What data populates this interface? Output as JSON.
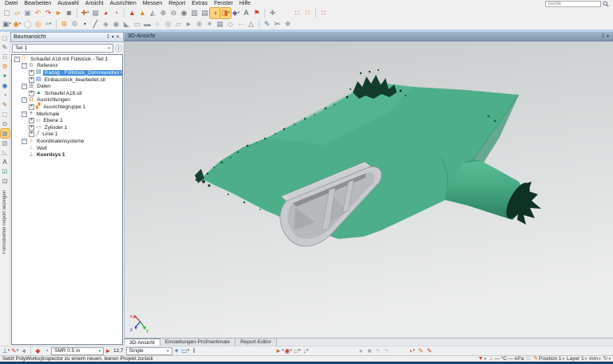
{
  "menu": {
    "items": [
      "Datei",
      "Bearbeiten",
      "Auswahl",
      "Ansicht",
      "Ausrichten",
      "Messen",
      "Report",
      "Extras",
      "Fenster",
      "Hilfe"
    ],
    "search_placeholder": "Suche"
  },
  "toolbar_row1": [
    {
      "name": "new-project",
      "g": "▢",
      "c": "#8d97a3"
    },
    {
      "name": "open-project",
      "g": "▱",
      "c": "#e08a28"
    },
    {
      "name": "save-project",
      "g": "▣",
      "c": "#8d97a3"
    },
    {
      "name": "undo",
      "g": "↶",
      "c": "#e08a28"
    },
    {
      "name": "redo",
      "g": "↷",
      "c": "#c2452c"
    },
    {
      "name": "share",
      "g": "►",
      "c": "#e08a28"
    },
    {
      "name": "snapshot",
      "g": "◙",
      "c": "#6e7681"
    },
    {
      "sep": true
    },
    {
      "name": "selection-tool",
      "g": "✚",
      "c": "#b8742c",
      "dd": true
    },
    {
      "name": "scene-view",
      "g": "▦",
      "c": "#8d97a3"
    },
    {
      "name": "probe-device-1",
      "g": "◕",
      "c": "#c2452c"
    },
    {
      "name": "probe-device-2",
      "g": "◔",
      "c": "#c2452c"
    },
    {
      "sep": true
    },
    {
      "name": "align-tool-1",
      "g": "▲",
      "c": "#c2452c"
    },
    {
      "name": "align-tool-2",
      "g": "▲",
      "c": "#e08a28"
    },
    {
      "name": "align-tool-3",
      "g": "◭",
      "c": "#8d97a3"
    },
    {
      "name": "zoom-in",
      "g": "⊕",
      "c": "#6e7681"
    },
    {
      "name": "zoom-out",
      "g": "⊖",
      "c": "#6e7681"
    },
    {
      "name": "eye-view",
      "g": "◉",
      "c": "#6e7681"
    },
    {
      "name": "window-split-1",
      "g": "▥",
      "c": "#6e7681"
    },
    {
      "name": "window-split-2",
      "g": "▤",
      "c": "#6e7681"
    },
    {
      "name": "flip-normals",
      "g": "◑",
      "c": "#d2691e",
      "hl": true
    },
    {
      "name": "orient-view",
      "g": "◨",
      "c": "#d2691e",
      "hl": true,
      "dd": true
    },
    {
      "name": "annotation",
      "g": "◆",
      "c": "#7b68a8",
      "dd": true
    },
    {
      "name": "text-label",
      "g": "A",
      "c": "#3c4650"
    },
    {
      "name": "flag-note",
      "g": "⚑",
      "c": "#c2452c"
    },
    {
      "sep": true
    },
    {
      "name": "small-crosshair",
      "g": "✚",
      "c": "#8d97a3"
    },
    {
      "gap": true
    },
    {
      "name": "cluster-objects-1",
      "g": "∷",
      "c": "#c2452c"
    },
    {
      "name": "cluster-objects-2",
      "g": "∷",
      "c": "#d2691e"
    },
    {
      "sep": true
    },
    {
      "name": "cluster-objects-3",
      "g": "∷",
      "c": "#c2452c"
    }
  ],
  "toolbar_row2": [
    {
      "name": "tree-display",
      "g": "▣",
      "c": "#6e7681",
      "dd": true
    },
    {
      "name": "control-reviewer",
      "g": "◉",
      "c": "#e08a28",
      "dd": true
    },
    {
      "name": "circle-tool",
      "g": "◯",
      "c": "#b0b5bb"
    },
    {
      "name": "gauge-tool",
      "g": "◎",
      "c": "#e08a28"
    },
    {
      "name": "curve-graph",
      "g": "≈",
      "c": "#8d97a3",
      "dd": true
    },
    {
      "sep": true
    },
    {
      "name": "feature-gear-orange",
      "g": "⚙",
      "c": "#e08a28"
    },
    {
      "name": "feature-gear-gray",
      "g": "⚙",
      "c": "#8d97a3"
    },
    {
      "name": "feature-point",
      "g": "•",
      "c": "#3c4650"
    },
    {
      "name": "feature-line",
      "g": "╱",
      "c": "#3c4650"
    },
    {
      "name": "feature-plane",
      "g": "◈",
      "c": "#8d97a3"
    },
    {
      "name": "feature-circle",
      "g": "◉",
      "c": "#8d97a3"
    },
    {
      "name": "feature-cone",
      "g": "◣",
      "c": "#8d97a3"
    },
    {
      "name": "feature-cylinder",
      "g": "▭",
      "c": "#8d97a3"
    },
    {
      "name": "feature-slab",
      "g": "▬",
      "c": "#8d97a3"
    },
    {
      "name": "feature-ellipse",
      "g": "○",
      "c": "#8d97a3"
    },
    {
      "name": "feature-torus",
      "g": "◎",
      "c": "#8d97a3"
    },
    {
      "name": "feature-slot",
      "g": "▱",
      "c": "#8d97a3"
    },
    {
      "name": "feature-arrow",
      "g": "►",
      "c": "#8d97a3"
    },
    {
      "name": "feature-sphere",
      "g": "⊕",
      "c": "#8d97a3"
    },
    {
      "name": "feature-surface",
      "g": "✶",
      "c": "#8d97a3"
    },
    {
      "name": "feature-patch",
      "g": "▦",
      "c": "#8d97a3"
    },
    {
      "name": "feature-polygon",
      "g": "◇",
      "c": "#8d97a3"
    },
    {
      "name": "feature-distance",
      "g": "--",
      "c": "#e08a28"
    },
    {
      "name": "feature-angle",
      "g": "△",
      "c": "#6e7681"
    },
    {
      "sep": true
    },
    {
      "name": "probe-compile",
      "g": "✎",
      "c": "#3a6fb0"
    },
    {
      "name": "probe-trim",
      "g": "✂",
      "c": "#5a6470"
    },
    {
      "name": "probe-group",
      "g": "❖",
      "c": "#8d97a3"
    }
  ],
  "left_strip": {
    "icons": [
      {
        "name": "sheet",
        "g": "▢",
        "c": "#8d97a3"
      },
      {
        "name": "pen-tool",
        "g": "✎",
        "c": "#5a6470"
      },
      {
        "name": "grid-list",
        "g": "☷",
        "c": "#8d97a3"
      },
      {
        "name": "gear-orange",
        "g": "⚙",
        "c": "#e08a28"
      },
      {
        "name": "star-green",
        "g": "✦",
        "c": "#2f8f5f"
      },
      {
        "name": "globe",
        "g": "◉",
        "c": "#3a6fb0"
      },
      {
        "name": "probe",
        "g": "◔",
        "c": "#c2452c"
      },
      {
        "name": "brush",
        "g": "✎",
        "c": "#b8742c"
      },
      {
        "name": "clamp",
        "g": "▢",
        "c": "#8d97a3"
      },
      {
        "name": "search-scene",
        "g": "⊙",
        "c": "#5a6470"
      },
      {
        "name": "table-view",
        "g": "▦",
        "c": "#8d97a3",
        "hl": true
      },
      {
        "name": "chart-view",
        "g": "▧",
        "c": "#8d97a3"
      },
      {
        "name": "wedge",
        "g": "◺",
        "c": "#8d97a3"
      },
      {
        "name": "letter-a",
        "g": "A",
        "c": "#3c4650"
      },
      {
        "name": "check-list",
        "g": "☑",
        "c": "#2f8f5f"
      },
      {
        "name": "camera",
        "g": "⊡",
        "c": "#5a6470"
      }
    ],
    "label": "Formatierten Report anzeigen"
  },
  "tree_panel": {
    "title": "Baumansicht",
    "part_selector": "Teil 1",
    "items": [
      {
        "label": "Schaufel A18 mit Füllstück - Teil 1",
        "level": 0,
        "icon": "info",
        "expander": "minus"
      },
      {
        "label": "Referenz",
        "level": 1,
        "icon": "reference",
        "expander": "minus"
      },
      {
        "label": "Radag - Füllstück_Dünnwandteil.log .stp",
        "level": 2,
        "icon": "cad-file",
        "expander": "plus",
        "selected": true
      },
      {
        "label": "Einbaustück_bearbeitet.stl",
        "level": 2,
        "icon": "cad-file",
        "expander": "plus"
      },
      {
        "label": "Daten",
        "level": 1,
        "icon": "data",
        "expander": "minus"
      },
      {
        "label": "Schaufel A18.stl",
        "level": 2,
        "icon": "mesh-file",
        "expander": "plus"
      },
      {
        "label": "Ausrichtungen",
        "level": 1,
        "icon": "alignments",
        "expander": "minus"
      },
      {
        "label": "Ausrichtegruppe 1",
        "level": 2,
        "icon": "alignment-group",
        "expander": "plus"
      },
      {
        "label": "Merkmale",
        "level": 1,
        "icon": "features",
        "expander": "minus"
      },
      {
        "label": "Ebene 1",
        "level": 2,
        "icon": "plane",
        "expander": "plus"
      },
      {
        "label": "Zylinder 1",
        "level": 2,
        "icon": "cylinder",
        "expander": "plus"
      },
      {
        "label": "Linie 1",
        "level": 2,
        "icon": "line",
        "expander": "plus"
      },
      {
        "label": "Koordinatensysteme",
        "level": 1,
        "icon": "coordsys",
        "expander": "minus"
      },
      {
        "label": "Welt",
        "level": 2,
        "icon": "world"
      },
      {
        "label": "Koordsys 1",
        "level": 2,
        "icon": "coordsys1",
        "bold": true
      }
    ],
    "tree_icons": {
      "info": {
        "g": "ⓘ",
        "c": "#e08a28"
      },
      "reference": {
        "g": "⚙",
        "c": "#8d97a3"
      },
      "cad-file": {
        "g": "▤",
        "c": "#3a6fb0"
      },
      "data": {
        "g": "☰",
        "c": "#5a6470"
      },
      "mesh-file": {
        "g": "▲",
        "c": "#2f9e6e"
      },
      "alignments": {
        "g": "⚙",
        "c": "#e08a28"
      },
      "alignment-group": {
        "g": "▞",
        "c": "#e08a28"
      },
      "features": {
        "g": "✦",
        "c": "#8d97a3"
      },
      "plane": {
        "g": "▱",
        "c": "#8d97a3"
      },
      "cylinder": {
        "g": "▭",
        "c": "#8d97a3"
      },
      "line": {
        "g": "╱",
        "c": "#5a6470"
      },
      "coordsys": {
        "g": "⊥",
        "c": "#e08a28"
      },
      "world": {
        "g": "⊥",
        "c": "#b0b5bb"
      },
      "coordsys1": {
        "g": "⊥",
        "c": "#3a6fb0"
      }
    }
  },
  "viewport": {
    "title": "3D-Ansicht",
    "axis_x": "x",
    "axis_y": "y",
    "axis_z": "z"
  },
  "tabs": [
    {
      "label": "3D-Ansicht",
      "active": true
    },
    {
      "label": "Einstellungen Prüfmerkmale",
      "active": false
    },
    {
      "label": "Report-Editor",
      "active": false
    }
  ],
  "bottom_toolbar": {
    "scan_size": "SMR 0.5 in",
    "point_size": "12,7",
    "view_mode": "Single",
    "left_icons": [
      {
        "name": "device-coordsys",
        "g": "⊥",
        "c": "#3a6fb0",
        "dd": true
      },
      {
        "name": "color-pen",
        "g": "✎",
        "c": "#c2452c",
        "dd": true
      },
      {
        "name": "eraser",
        "g": "◄",
        "c": "#8d97a3"
      },
      {
        "sep": true
      },
      {
        "name": "measure-flask",
        "g": "◆",
        "c": "#c2452c"
      },
      {
        "name": "timer-clock",
        "g": "◔",
        "c": "#5a6470"
      }
    ],
    "mid_icons": [
      {
        "name": "probe-person",
        "g": "✶",
        "c": "#3a6fb0"
      },
      {
        "name": "window-mode",
        "g": "▭",
        "c": "#3a6fb0",
        "dd": true
      },
      {
        "name": "pause-bars",
        "g": "‖",
        "c": "#6e7681"
      }
    ],
    "right_icons_1": [
      {
        "name": "paint-brush",
        "g": "►",
        "c": "#b8742c",
        "dd": true
      },
      {
        "name": "target-scan",
        "g": "◉",
        "c": "#c2452c",
        "dd": true
      },
      {
        "name": "folder-scan",
        "g": "▱",
        "c": "#b8742c",
        "dd": true
      },
      {
        "name": "pin-drop",
        "g": "↓",
        "c": "#5a6470",
        "dd": true
      }
    ],
    "right_icons_2": [
      {
        "name": "record",
        "g": "●",
        "c": "#a8aeb4"
      },
      {
        "name": "stop",
        "g": "■",
        "c": "#a8aeb4"
      },
      {
        "name": "undo-step",
        "g": "↖",
        "c": "#b8bdc2"
      },
      {
        "name": "undo-step-2",
        "g": "↖",
        "c": "#b8bdc2"
      }
    ],
    "right_icons_3": [
      {
        "name": "cursor-run",
        "g": "◗",
        "c": "#d2691e",
        "dd": true
      },
      {
        "name": "digitize-1",
        "g": "✎",
        "c": "#d2691e"
      },
      {
        "name": "digitize-2",
        "g": "✎",
        "c": "#c2452c"
      }
    ]
  },
  "status_bar": {
    "message": "Setzt PolyWorks|Inspector zu einem neuen, leeren Projekt zurück",
    "climate": "— °C  — kPa",
    "position": "Position 1",
    "layer": "Layer 1",
    "units": "mm"
  }
}
